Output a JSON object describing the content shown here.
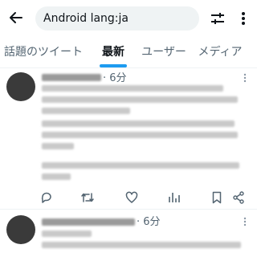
{
  "search": {
    "query": "Android lang:ja"
  },
  "tabs": [
    {
      "label": "話題のツイート"
    },
    {
      "label": "最新"
    },
    {
      "label": "ユーザー"
    },
    {
      "label": "メディア"
    }
  ],
  "tweets": [
    {
      "time": "· 6分"
    },
    {
      "time": "· 6分"
    }
  ],
  "icons": {
    "back": "arrow-left-icon",
    "filter": "sliders-icon",
    "more": "more-vertical-icon",
    "reply": "reply-icon",
    "retweet": "retweet-icon",
    "like": "heart-icon",
    "views": "bar-chart-icon",
    "bookmark": "bookmark-icon",
    "share": "share-icon"
  },
  "colors": {
    "accent": "#1d9bf0",
    "text": "#0f1419",
    "muted": "#536471"
  }
}
